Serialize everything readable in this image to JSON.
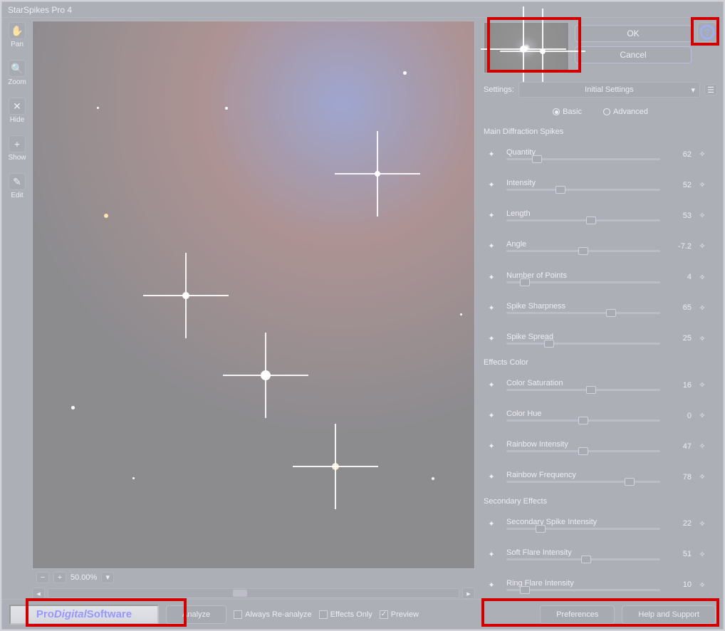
{
  "title": "StarSpikes Pro 4",
  "tools": [
    {
      "label": "Pan",
      "icon": "✋",
      "name": "pan"
    },
    {
      "label": "Zoom",
      "icon": "🔍",
      "name": "zoom"
    },
    {
      "label": "Hide",
      "icon": "✕",
      "name": "hide"
    },
    {
      "label": "Show",
      "icon": "+",
      "name": "show"
    },
    {
      "label": "Edit",
      "icon": "✎",
      "name": "edit"
    }
  ],
  "zoom": {
    "level": "50.00%"
  },
  "buttons": {
    "ok": "OK",
    "cancel": "Cancel",
    "analyze": "Analyze",
    "preferences": "Preferences",
    "help": "Help and Support"
  },
  "settings": {
    "label": "Settings:",
    "selected": "Initial Settings"
  },
  "mode": {
    "basic": "Basic",
    "advanced": "Advanced",
    "selected": "basic"
  },
  "sections": {
    "main": {
      "title": "Main Diffraction Spikes",
      "params": [
        {
          "label": "Quantity",
          "value": "62",
          "pos": 20
        },
        {
          "label": "Intensity",
          "value": "52",
          "pos": 35
        },
        {
          "label": "Length",
          "value": "53",
          "pos": 55
        },
        {
          "label": "Angle",
          "value": "-7.2",
          "pos": 50
        },
        {
          "label": "Number of Points",
          "value": "4",
          "pos": 12
        },
        {
          "label": "Spike Sharpness",
          "value": "65",
          "pos": 68
        },
        {
          "label": "Spike Spread",
          "value": "25",
          "pos": 28
        }
      ]
    },
    "color": {
      "title": "Effects Color",
      "params": [
        {
          "label": "Color Saturation",
          "value": "16",
          "pos": 55
        },
        {
          "label": "Color Hue",
          "value": "0",
          "pos": 50
        },
        {
          "label": "Rainbow Intensity",
          "value": "47",
          "pos": 50
        },
        {
          "label": "Rainbow Frequency",
          "value": "78",
          "pos": 80
        }
      ]
    },
    "secondary": {
      "title": "Secondary Effects",
      "params": [
        {
          "label": "Secondary Spike Intensity",
          "value": "22",
          "pos": 22
        },
        {
          "label": "Soft Flare Intensity",
          "value": "51",
          "pos": 52
        },
        {
          "label": "Ring Flare Intensity",
          "value": "10",
          "pos": 12
        }
      ]
    }
  },
  "checks": {
    "reanalyze": "Always Re-analyze",
    "effectsOnly": "Effects Only",
    "preview": "Preview"
  },
  "brand": {
    "p1": "Pro",
    "p2": "Digital",
    "p3": " Software"
  }
}
